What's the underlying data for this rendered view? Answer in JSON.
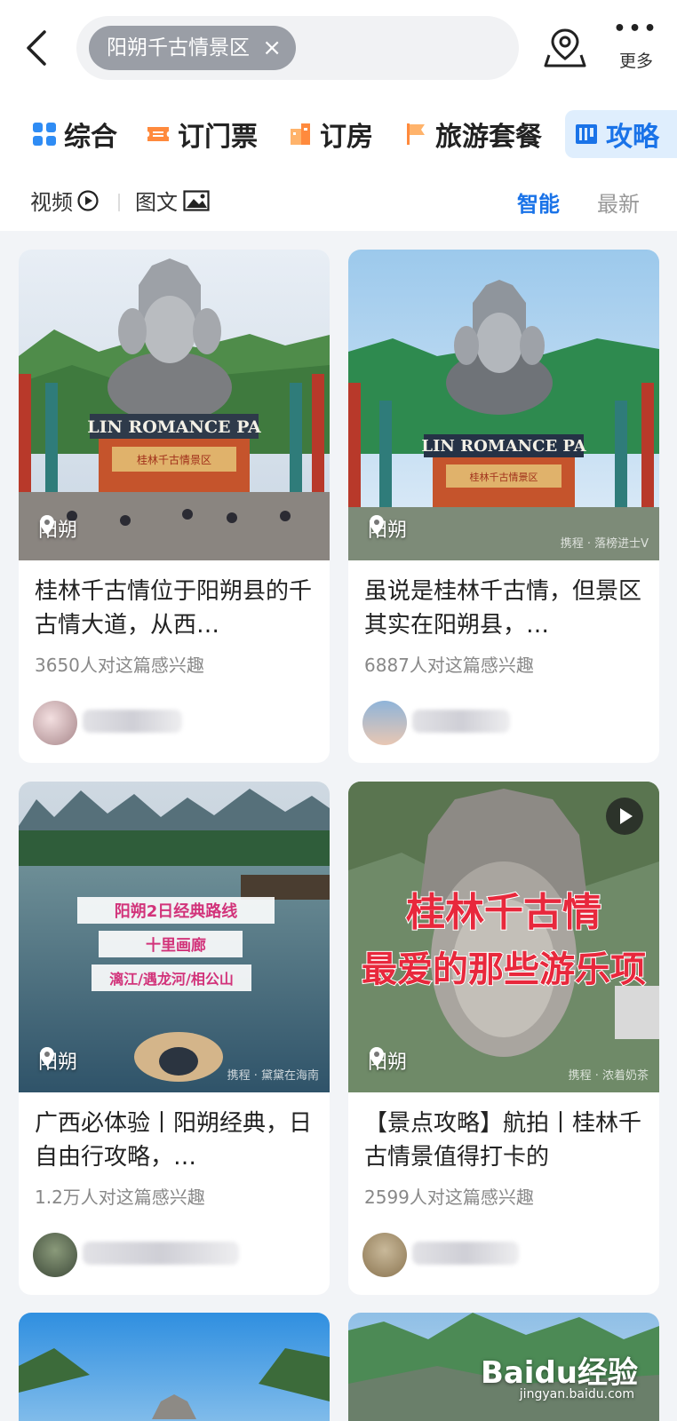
{
  "search": {
    "chip_label": "阳朔千古情景区",
    "chip_close": "×"
  },
  "header": {
    "more_label": "更多"
  },
  "tabs": [
    {
      "label": "综合"
    },
    {
      "label": "订门票"
    },
    {
      "label": "订房"
    },
    {
      "label": "旅游套餐"
    },
    {
      "label": "攻略",
      "active": true
    }
  ],
  "filters": {
    "video": "视频",
    "photo": "图文",
    "smart": "智能",
    "latest": "最新"
  },
  "cards": [
    {
      "location": "阳朔",
      "title": "桂林千古情位于阳朔县的千古情大道，从西…",
      "meta": "3650人对这篇感兴趣",
      "sign": "LIN ROMANCE PA",
      "gate_text": "桂林千古情景区"
    },
    {
      "location": "阳朔",
      "title": "虽说是桂林千古情，但景区其实在阳朔县，…",
      "meta": "6887人对这篇感兴趣",
      "sign": "LIN ROMANCE PA",
      "gate_text": "桂林千古情景区",
      "watermark": "携程 · 落榜进士V"
    },
    {
      "location": "阳朔",
      "title": "广西必体验丨阳朔经典，日自由行攻略，…",
      "meta": "1.2万人对这篇感兴趣",
      "overlay": [
        "阳朔2日经典路线",
        "十里画廊",
        "漓江/遇龙河/相公山"
      ],
      "watermark": "携程 · 黛黛在海南"
    },
    {
      "location": "阳朔",
      "title": "【景点攻略】航拍丨桂林千古情景值得打卡的",
      "meta": "2599人对这篇感兴趣",
      "overlay": [
        "桂林千古情",
        "最爱的那些游乐项"
      ],
      "watermark": "携程 · 浓着奶茶"
    }
  ],
  "watermark": {
    "brand": "Baidu经验",
    "url": "jingyan.baidu.com"
  },
  "colors": {
    "accent": "#1a73e8",
    "chip": "#9a9ea6",
    "muted": "#888888",
    "overlay_red": "#e8283c"
  },
  "icons": [
    "back-arrow-icon",
    "close-icon",
    "map-location-icon",
    "more-dots-icon",
    "grid-icon",
    "ticket-icon",
    "hotel-icon",
    "flag-icon",
    "guide-icon",
    "play-circle-icon",
    "image-icon",
    "location-pin-icon",
    "play-icon"
  ]
}
